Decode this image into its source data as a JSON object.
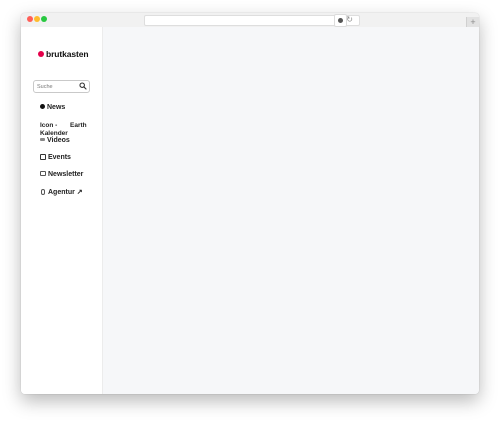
{
  "browser": {
    "reload_glyph": "↻",
    "new_tab_glyph": "+",
    "ext_icon": "privacy-badge-icon"
  },
  "sidebar": {
    "logo_text": "brutkasten",
    "logo_color": "#e5004a",
    "search": {
      "placeholder": "Suche",
      "icon": "search-icon"
    },
    "items": [
      {
        "label": "News",
        "icon": "news-icon"
      },
      {
        "label_line1": "Icon -",
        "label_line2": "Kalender",
        "earth": "Earth"
      },
      {
        "label": "Videos",
        "icon": "video-icon"
      },
      {
        "label": "Events",
        "icon": "calendar-icon"
      },
      {
        "label": "Newsletter",
        "icon": "mail-icon"
      },
      {
        "label": "Agentur ↗",
        "icon": "mic-icon"
      }
    ]
  }
}
